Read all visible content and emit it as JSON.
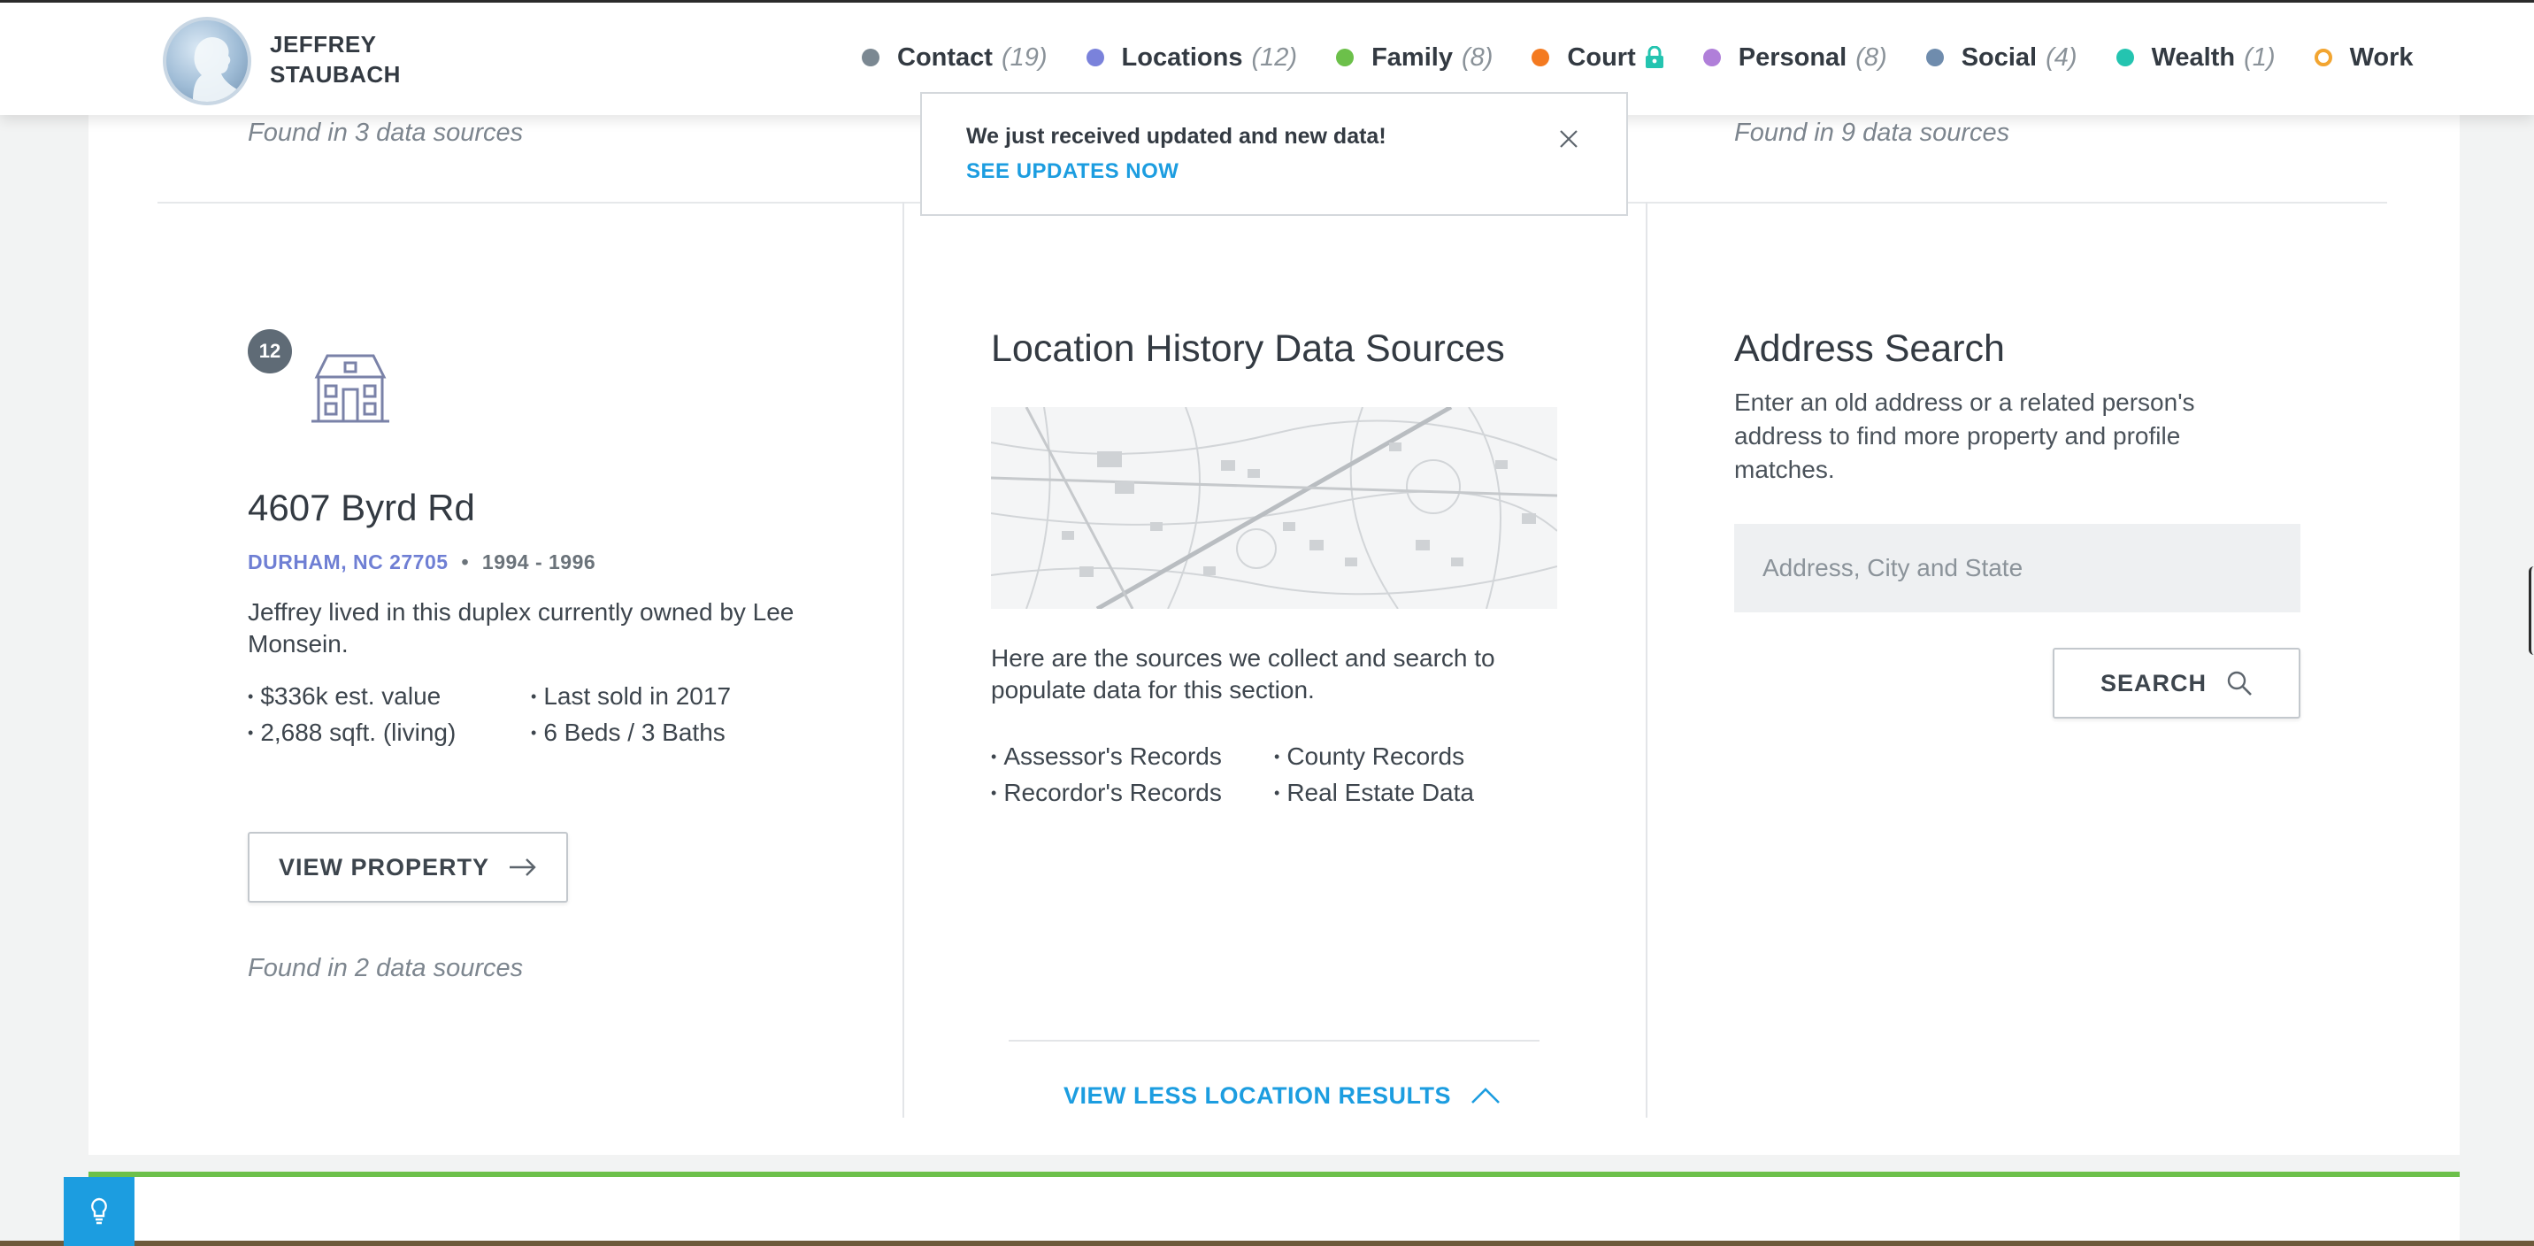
{
  "profile": {
    "first_name": "JEFFREY",
    "last_name": "STAUBACH"
  },
  "nav": [
    {
      "label": "Contact",
      "count": "(19)",
      "color": "#7b8892"
    },
    {
      "label": "Locations",
      "count": "(12)",
      "color": "#7a82db"
    },
    {
      "label": "Family",
      "count": "(8)",
      "color": "#6cc04a"
    },
    {
      "label": "Court",
      "count": "",
      "color": "#f47a20",
      "locked": true
    },
    {
      "label": "Personal",
      "count": "(8)",
      "color": "#b07fd9"
    },
    {
      "label": "Social",
      "count": "(4)",
      "color": "#6f8cad"
    },
    {
      "label": "Wealth",
      "count": "(1)",
      "color": "#24c4b0"
    },
    {
      "label": "Work",
      "count": "",
      "color": "#f2a531",
      "outline": true
    }
  ],
  "toast": {
    "message": "We just received updated and new data!",
    "link": "SEE UPDATES NOW"
  },
  "previous_row": {
    "left_found": "Found in 3 data sources",
    "right_found": "Found in 9 data sources"
  },
  "property": {
    "index": "12",
    "address": "4607 Byrd Rd",
    "city": "DURHAM, NC 27705",
    "separator": "•",
    "years": "1994 - 1996",
    "description": "Jeffrey lived in this duplex currently owned by Lee Monsein.",
    "facts_left": [
      "$336k est. value",
      "2,688 sqft. (living)"
    ],
    "facts_right": [
      "Last sold in 2017",
      "6 Beds / 3 Baths"
    ],
    "button_label": "VIEW PROPERTY",
    "found": "Found in 2 data sources"
  },
  "sources": {
    "title": "Location History Data Sources",
    "description": "Here are the sources we collect and search to populate data for this section.",
    "list_left": [
      "Assessor's Records",
      "Recordor's Records"
    ],
    "list_right": [
      "County Records",
      "Real Estate Data"
    ]
  },
  "address_search": {
    "title": "Address Search",
    "description": "Enter an old address or a related person's address to find more property and profile matches.",
    "placeholder": "Address, City and State",
    "button_label": "SEARCH"
  },
  "view_less_label": "VIEW LESS LOCATION RESULTS",
  "colors": {
    "accent": "#1c9de0",
    "green": "#6cc04a",
    "city": "#6f7fd4"
  }
}
